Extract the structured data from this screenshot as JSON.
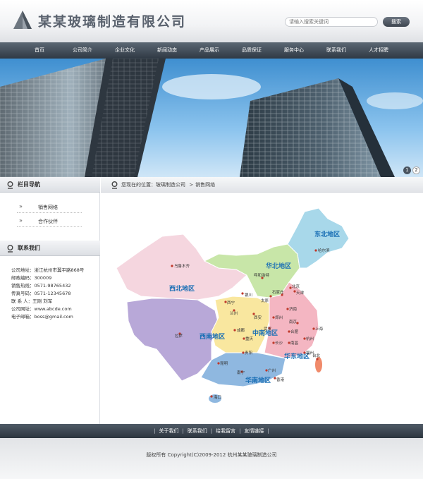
{
  "header": {
    "company_name": "某某玻璃制造有限公司",
    "search_placeholder": "请输入搜索关键词",
    "search_button": "搜索"
  },
  "nav": {
    "items": [
      "首页",
      "公司简介",
      "企业文化",
      "新闻动态",
      "产品展示",
      "品质保证",
      "服务中心",
      "联系我们",
      "人才招聘"
    ]
  },
  "banner": {
    "pages": [
      "1",
      "2"
    ],
    "active_page": "1"
  },
  "sidebar": {
    "nav_title": "栏目导航",
    "items": [
      {
        "label": "销售网络"
      },
      {
        "label": "合作伙伴"
      }
    ],
    "contact_title": "联系我们",
    "contact": [
      "公司地址：浙江杭州市翼平路868号",
      "邮政编码：300009",
      "销售热线：0571-98765432",
      "传真号码：0571-12345678",
      "联 系 人：王刚 刘军",
      "公司网址：www.abcde.com",
      "电子邮箱：boss@gmail.com"
    ]
  },
  "breadcrumb": {
    "prefix": "您现在的位置：",
    "home": "玻璃制造公司",
    "separator": ">",
    "current": "销售网络"
  },
  "map": {
    "regions": [
      "东北地区",
      "华北地区",
      "西北地区",
      "中南地区",
      "西南地区",
      "华东地区",
      "华南地区"
    ],
    "cities": [
      "哈尔滨",
      "乌鲁木齐",
      "呼和浩特",
      "北京",
      "天津",
      "石家庄",
      "太原",
      "银川",
      "西宁",
      "兰州",
      "西安",
      "郑州",
      "济南",
      "南京",
      "上海",
      "合肥",
      "武汉",
      "杭州",
      "成都",
      "重庆",
      "长沙",
      "南昌",
      "福州",
      "贵阳",
      "拉萨",
      "昆明",
      "南宁",
      "广州",
      "香港",
      "海口",
      "台北"
    ]
  },
  "footer": {
    "links": [
      "关于我们",
      "联系我们",
      "给我留言",
      "友情链接"
    ],
    "copyright": "版权所有 Copyright(C)2009-2012 杭州某某玻璃制造公司"
  },
  "colors": {
    "nav_bg": "#3f4a56",
    "region_northeast": "#a8d8ea",
    "region_north": "#c8e6a8",
    "region_northwest": "#f5d6df",
    "region_southwest": "#b8a8d8",
    "region_central": "#f9e79f",
    "region_east": "#f4b6c2",
    "region_south": "#8fb8e0"
  }
}
